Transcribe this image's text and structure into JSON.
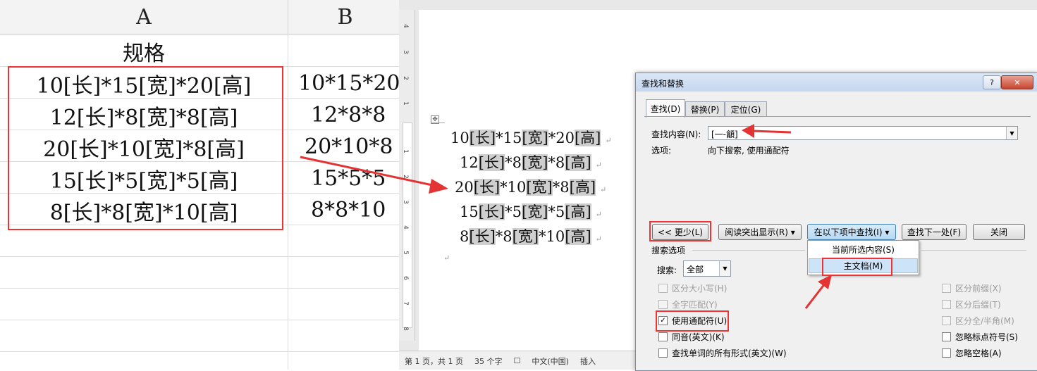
{
  "excel": {
    "columns": [
      "A",
      "B"
    ],
    "header_cell": "规格",
    "column_a": [
      "10[长]*15[宽]*20[高]",
      "12[长]*8[宽]*8[高]",
      "20[长]*10[宽]*8[高]",
      "15[长]*5[宽]*5[高]",
      "8[长]*8[宽]*10[高]"
    ],
    "column_b": [
      "10*15*20",
      "12*8*8",
      "20*10*8",
      "15*5*5",
      "8*8*10"
    ]
  },
  "word": {
    "ruler_numbers": [
      "4",
      "3",
      "2",
      "1",
      "1",
      "2",
      "3",
      "4",
      "5",
      "6",
      "7",
      "8"
    ],
    "lines": [
      [
        "10",
        "[长]",
        "*15",
        "[宽]",
        "*20",
        "[高]"
      ],
      [
        "12",
        "[长]",
        "*8",
        "[宽]",
        "*8",
        "[高]"
      ],
      [
        "20",
        "[长]",
        "*10",
        "[宽]",
        "*8",
        "[高]"
      ],
      [
        "15",
        "[长]",
        "*5",
        "[宽]",
        "*5",
        "[高]"
      ],
      [
        "8",
        "[长]",
        "*8",
        "[宽]",
        "*10",
        "[高]"
      ]
    ],
    "paragraph_mark": "↵",
    "status": {
      "page": "第 1 页，共 1 页",
      "words": "35 个字",
      "language": "中文(中国)",
      "mode": "插入"
    }
  },
  "dialog": {
    "title": "查找和替换",
    "help_label": "?",
    "close_label": "✕",
    "tabs": [
      "查找(D)",
      "替换(P)",
      "定位(G)"
    ],
    "find_label": "查找内容(N):",
    "find_value": "[一-龥]",
    "options_label": "选项:",
    "options_value": "向下搜索, 使用通配符",
    "buttons": {
      "less": "<< 更少(L)",
      "reading_highlight": "阅读突出显示(R) ▾",
      "find_in": "在以下项中查找(I) ▾",
      "find_next": "查找下一处(F)",
      "close": "关闭"
    },
    "find_in_menu": [
      "当前所选内容(S)",
      "主文档(M)"
    ],
    "search_options_title": "搜索选项",
    "search_label": "搜索:",
    "search_value": "全部",
    "left_options": [
      {
        "label": "区分大小写(H)",
        "checked": false,
        "disabled": true
      },
      {
        "label": "全字匹配(Y)",
        "checked": false,
        "disabled": true
      },
      {
        "label": "使用通配符(U)",
        "checked": true,
        "disabled": false
      },
      {
        "label": "同音(英文)(K)",
        "checked": false,
        "disabled": false
      },
      {
        "label": "查找单词的所有形式(英文)(W)",
        "checked": false,
        "disabled": false
      }
    ],
    "right_options": [
      {
        "label": "区分前缀(X)",
        "checked": false,
        "disabled": true
      },
      {
        "label": "区分后缀(T)",
        "checked": false,
        "disabled": true
      },
      {
        "label": "区分全/半角(M)",
        "checked": false,
        "disabled": true
      },
      {
        "label": "忽略标点符号(S)",
        "checked": false,
        "disabled": false
      },
      {
        "label": "忽略空格(A)",
        "checked": false,
        "disabled": false
      }
    ]
  },
  "colors": {
    "annotation_red": "#e33333",
    "highlight": "#cfcfcf"
  }
}
